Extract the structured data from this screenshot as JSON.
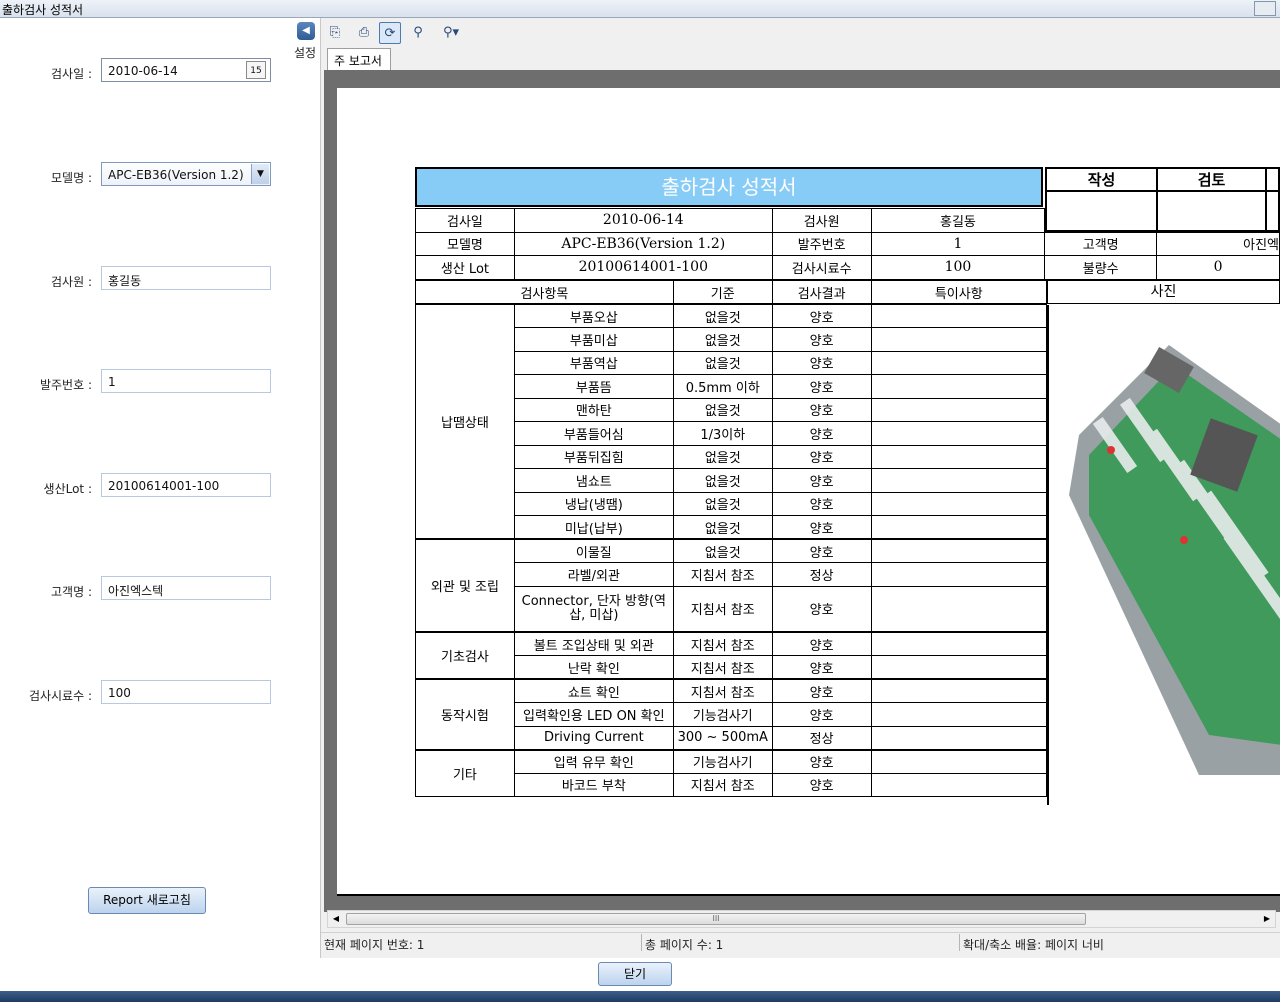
{
  "window": {
    "title": "출하검사 성적서"
  },
  "form": {
    "fields": [
      {
        "label": "검사일 :",
        "value": "2010-06-14"
      },
      {
        "label": "모델명 :",
        "value": "APC-EB36(Version 1.2)"
      },
      {
        "label": "검사원 :",
        "value": "홍길동"
      },
      {
        "label": "발주번호 :",
        "value": "1"
      },
      {
        "label": "생산Lot :",
        "value": "20100614001-100"
      },
      {
        "label": "고객명 :",
        "value": "아진엑스텍"
      },
      {
        "label": "검사시료수 :",
        "value": "100"
      }
    ],
    "calendar_day": "15",
    "refresh_button": "Report 새로고침"
  },
  "collapse": {
    "label": "설정"
  },
  "viewer": {
    "tab": "주 보고서",
    "status": {
      "current_page": "현재 페이지 번호: 1",
      "total_pages": "총 페이지 수: 1",
      "zoom": "확대/축소 배율: 페이지 너비"
    },
    "scroll_grip": "III"
  },
  "report": {
    "title": "출하검사 성적서",
    "approval": {
      "write": "작성",
      "review": "검토"
    },
    "header_rows": [
      [
        "검사일",
        "2010-06-14",
        "검사원",
        "홍길동"
      ],
      [
        "모델명",
        "APC-EB36(Version 1.2)",
        "발주번호",
        "1",
        "고객명",
        "아진엑"
      ],
      [
        "생산 Lot",
        "20100614001-100",
        "검사시료수",
        "100",
        "불량수",
        "0"
      ]
    ],
    "columns": {
      "item": "검사항목",
      "standard": "기준",
      "result": "검사결과",
      "note": "특이사항",
      "photo": "사진"
    },
    "groups": [
      {
        "name": "납땜상태",
        "rows": [
          [
            "부품오삽",
            "없을것",
            "양호"
          ],
          [
            "부품미삽",
            "없을것",
            "양호"
          ],
          [
            "부품역삽",
            "없을것",
            "양호"
          ],
          [
            "부품뜸",
            "0.5mm 이하",
            "양호"
          ],
          [
            "맨하탄",
            "없을것",
            "양호"
          ],
          [
            "부품들어심",
            "1/3이하",
            "양호"
          ],
          [
            "부품뒤집힘",
            "없을것",
            "양호"
          ],
          [
            "냄쇼트",
            "없을것",
            "양호"
          ],
          [
            "냉납(냉땜)",
            "없을것",
            "양호"
          ],
          [
            "미납(납부)",
            "없을것",
            "양호"
          ]
        ]
      },
      {
        "name": "외관 및 조립",
        "rows": [
          [
            "이물질",
            "없을것",
            "양호"
          ],
          [
            "라벨/외관",
            "지침서 참조",
            "정상"
          ],
          [
            "Connector, 단자 방향(역삽, 미삽)",
            "지침서 참조",
            "양호"
          ]
        ]
      },
      {
        "name": "기초검사",
        "rows": [
          [
            "볼트 조입상태 및 외관",
            "지침서 참조",
            "양호"
          ],
          [
            "난락 확인",
            "지침서 참조",
            "양호"
          ]
        ]
      },
      {
        "name": "동작시험",
        "rows": [
          [
            "쇼트 확인",
            "지침서 참조",
            "양호"
          ],
          [
            "입력확인용 LED ON 확인",
            "기능검사기",
            "양호"
          ],
          [
            "Driving Current",
            "300 ~ 500mA",
            "정상"
          ]
        ]
      },
      {
        "name": "기타",
        "rows": [
          [
            "입력 유무 확인",
            "기능검사기",
            "양호"
          ],
          [
            "바코드 부착",
            "지침서 참조",
            "양호"
          ]
        ]
      }
    ]
  },
  "close_button": "닫기"
}
